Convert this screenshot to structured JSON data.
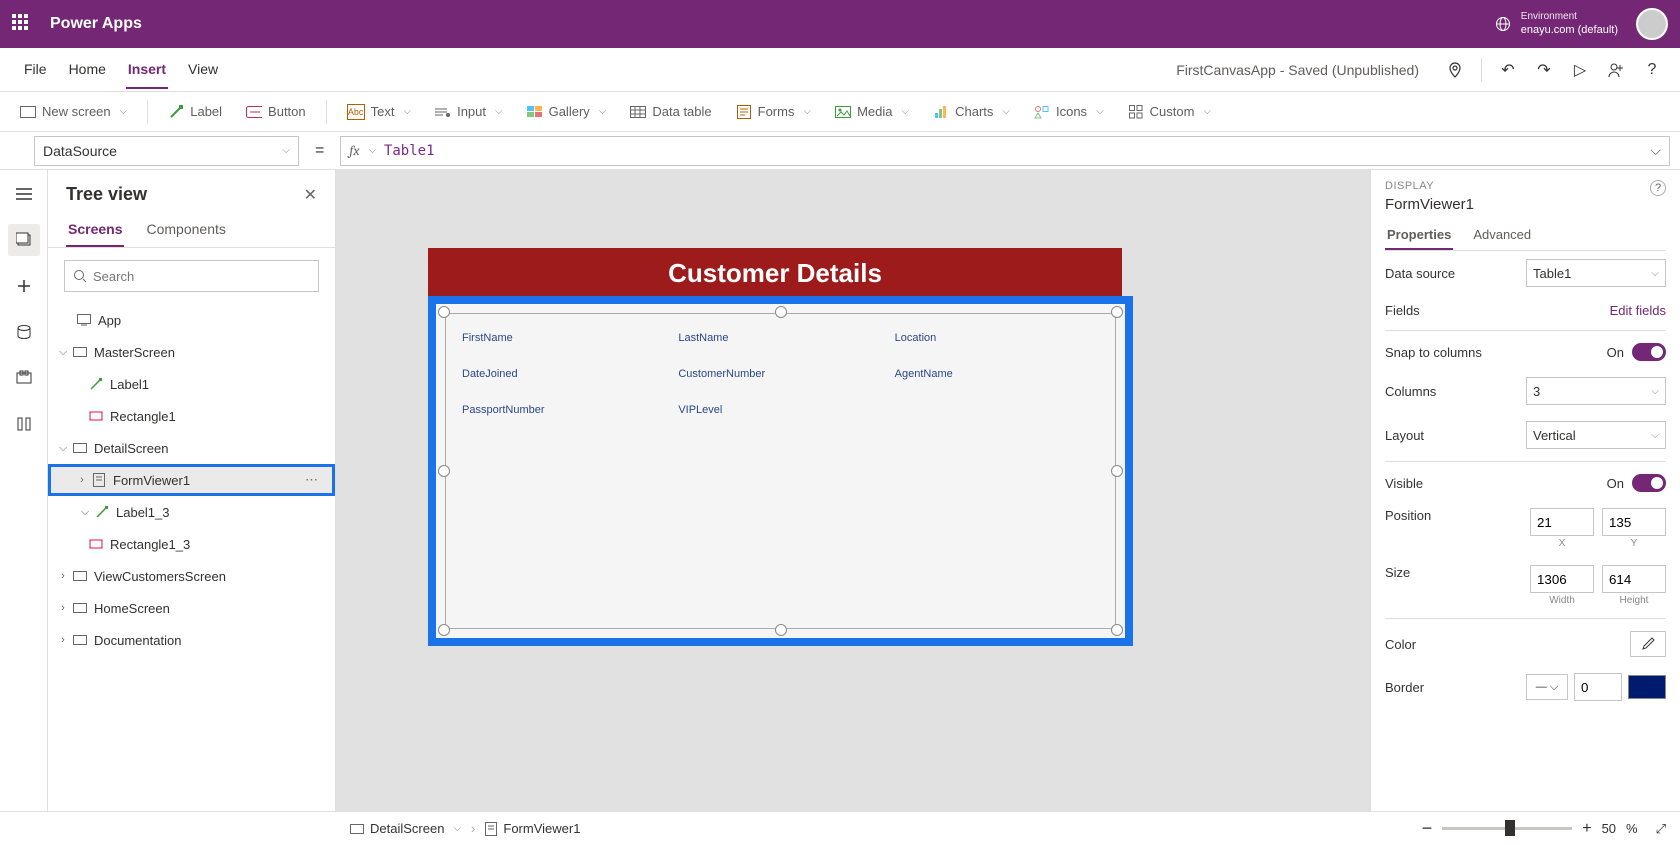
{
  "topbar": {
    "brand": "Power Apps",
    "env_label": "Environment",
    "env_value": "enayu.com (default)"
  },
  "menubar": {
    "tabs": {
      "file": "File",
      "home": "Home",
      "insert": "Insert",
      "view": "View"
    },
    "app_title": "FirstCanvasApp - Saved (Unpublished)"
  },
  "ribbon": {
    "new_screen": "New screen",
    "label": "Label",
    "button": "Button",
    "text": "Text",
    "input": "Input",
    "gallery": "Gallery",
    "data_table": "Data table",
    "forms": "Forms",
    "media": "Media",
    "charts": "Charts",
    "icons": "Icons",
    "custom": "Custom"
  },
  "fbar": {
    "property": "DataSource",
    "formula": "Table1"
  },
  "tree": {
    "title": "Tree view",
    "tab_screens": "Screens",
    "tab_components": "Components",
    "search_ph": "Search",
    "app": "App",
    "master": "MasterScreen",
    "label1": "Label1",
    "rect1": "Rectangle1",
    "detail": "DetailScreen",
    "formviewer": "FormViewer1",
    "label13": "Label1_3",
    "rect13": "Rectangle1_3",
    "viewcust": "ViewCustomersScreen",
    "home": "HomeScreen",
    "doc": "Documentation"
  },
  "canvas": {
    "header": "Customer Details",
    "f1": "FirstName",
    "f2": "LastName",
    "f3": "Location",
    "f4": "DateJoined",
    "f5": "CustomerNumber",
    "f6": "AgentName",
    "f7": "PassportNumber",
    "f8": "VIPLevel"
  },
  "props": {
    "caption": "DISPLAY",
    "name": "FormViewer1",
    "tab_props": "Properties",
    "tab_adv": "Advanced",
    "data_source": "Data source",
    "ds_val": "Table1",
    "fields": "Fields",
    "edit_fields": "Edit fields",
    "snap": "Snap to columns",
    "on": "On",
    "columns": "Columns",
    "cols_val": "3",
    "layout": "Layout",
    "layout_val": "Vertical",
    "visible": "Visible",
    "position": "Position",
    "pos_x": "21",
    "pos_y": "135",
    "xl": "X",
    "yl": "Y",
    "size": "Size",
    "w": "1306",
    "h": "614",
    "wl": "Width",
    "hl": "Height",
    "color": "Color",
    "border": "Border",
    "border_val": "0"
  },
  "bottom": {
    "crumb1": "DetailScreen",
    "crumb2": "FormViewer1",
    "zoom": "50",
    "pct": "%"
  }
}
